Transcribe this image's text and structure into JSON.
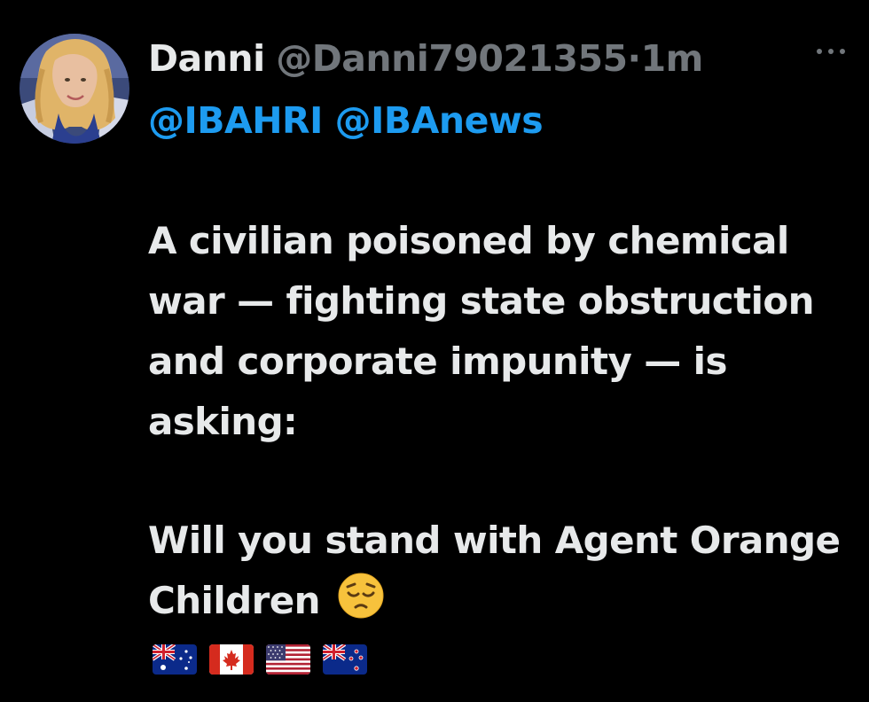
{
  "post": {
    "author": {
      "display_name": "Danni",
      "handle": "@Danni79021355",
      "separator": "·",
      "time": "1m"
    },
    "more_icon": "more-horizontal-icon",
    "mentions": [
      "@IBAHRI",
      "@IBAnews"
    ],
    "paragraph_1": "A civilian poisoned by chemical war — fighting state obstruction and corporate impunity — is asking:",
    "paragraph_2": "Will you stand with Agent Orange Children",
    "emoji": "pensive-face-icon",
    "flags": [
      "australia-flag-icon",
      "canada-flag-icon",
      "united-states-flag-icon",
      "new-zealand-flag-icon"
    ]
  },
  "colors": {
    "background": "#000000",
    "primary_text": "#e7e9ea",
    "secondary_text": "#71767b",
    "link": "#1d9bf0"
  }
}
